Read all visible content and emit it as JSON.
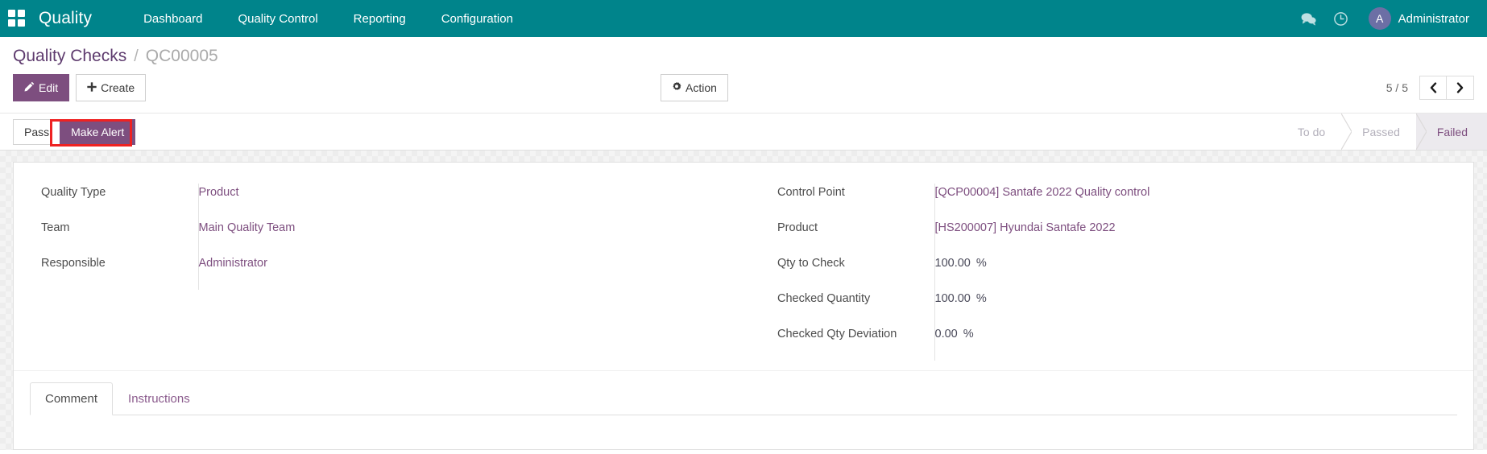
{
  "navbar": {
    "apps_icon": "apps-grid-icon",
    "brand": "Quality",
    "menu": [
      {
        "label": "Dashboard"
      },
      {
        "label": "Quality Control"
      },
      {
        "label": "Reporting"
      },
      {
        "label": "Configuration"
      }
    ],
    "icons": [
      {
        "name": "messages-icon"
      },
      {
        "name": "activities-clock-icon"
      }
    ],
    "user": {
      "avatar_initial": "A",
      "name": "Administrator"
    },
    "colors": {
      "background": "#00848b",
      "text": "#ffffff",
      "avatar_bg": "#6c6fa5"
    }
  },
  "control_panel": {
    "breadcrumb": {
      "root": "Quality Checks",
      "separator": "/",
      "current": "QC00005"
    },
    "buttons": {
      "edit": "Edit",
      "create": "Create",
      "action": "Action"
    },
    "pager": {
      "count": "5 / 5",
      "prev": "‹",
      "next": "›"
    }
  },
  "statusbar": {
    "buttons": [
      {
        "label": "Pass",
        "highlighted": false
      },
      {
        "label": "Make Alert",
        "highlighted": true
      }
    ],
    "highlight_color": "#ee2222",
    "stages": [
      {
        "label": "To do",
        "active": false
      },
      {
        "label": "Passed",
        "active": false
      },
      {
        "label": "Failed",
        "active": true
      }
    ]
  },
  "form": {
    "left_fields": [
      {
        "label": "Quality Type",
        "value": "Product",
        "unit": ""
      },
      {
        "label": "Team",
        "value": "Main Quality Team",
        "unit": ""
      },
      {
        "label": "Responsible",
        "value": "Administrator",
        "unit": ""
      }
    ],
    "right_fields": [
      {
        "label": "Control Point",
        "value": "[QCP00004] Santafe 2022 Quality control",
        "unit": ""
      },
      {
        "label": "Product",
        "value": "[HS200007] Hyundai Santafe 2022",
        "unit": ""
      },
      {
        "label": "Qty to Check",
        "value": "100.00",
        "unit": "%"
      },
      {
        "label": "Checked Quantity",
        "value": "100.00",
        "unit": "%"
      },
      {
        "label": "Checked Qty Deviation",
        "value": "0.00",
        "unit": "%"
      }
    ]
  },
  "notebook": {
    "tabs": [
      {
        "label": "Comment",
        "active": true
      },
      {
        "label": "Instructions",
        "active": false
      }
    ]
  }
}
